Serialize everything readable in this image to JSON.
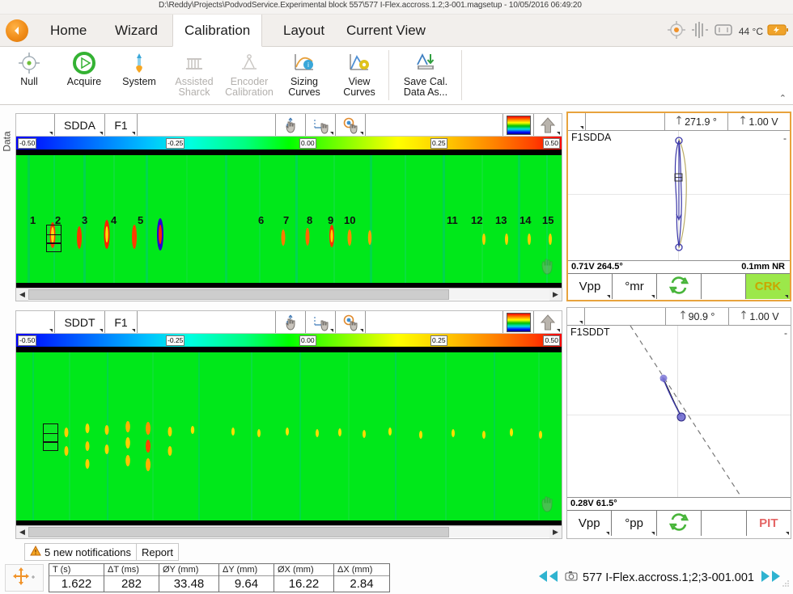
{
  "window": {
    "title": "D:\\Reddy\\Projects\\PodvodService.Experimental block 557\\577 I-Flex.accross.1.2;3-001.magsetup - 10/05/2016 06:49:20"
  },
  "ribbon": {
    "back_icon": "back-arrow-icon",
    "tabs": [
      {
        "label": "Home",
        "active": false
      },
      {
        "label": "Wizard",
        "active": false
      },
      {
        "label": "Calibration",
        "active": true
      },
      {
        "label": "Layout",
        "active": false
      },
      {
        "label": "Current View",
        "active": false
      }
    ],
    "status": {
      "probe_icon": "probe-target-icon",
      "signal_icon": "waveform-icon",
      "device_icon": "device-icon",
      "temperature": "44 °C",
      "battery_icon": "battery-icon"
    },
    "collapse_label": "⌃",
    "buttons": [
      {
        "label": "Null",
        "icon": "null-target-icon",
        "disabled": false
      },
      {
        "label": "Acquire",
        "icon": "play-circle-icon",
        "disabled": false
      },
      {
        "label": "System",
        "icon": "system-probe-icon",
        "disabled": false
      },
      {
        "label": "Assisted\nSharck",
        "icon": "assisted-sharck-icon",
        "disabled": true
      },
      {
        "label": "Encoder\nCalibration",
        "icon": "encoder-calibration-icon",
        "disabled": true
      },
      {
        "label": "Sizing\nCurves",
        "icon": "sizing-curves-icon",
        "disabled": false
      },
      {
        "label": "View\nCurves",
        "icon": "view-curves-icon",
        "disabled": false
      },
      {
        "label": "Save Cal.\nData As...",
        "icon": "save-cal-data-icon",
        "disabled": false
      }
    ]
  },
  "side_tab": {
    "label": "Data"
  },
  "cscans": [
    {
      "channel": "SDDA",
      "frequency": "F1",
      "tools": [
        "pan-tool-icon",
        "shift-tool-icon",
        "zoom-tool-icon"
      ],
      "palette_icon": "palette-swatch-icon",
      "arrow_icon": "arrow-up-icon",
      "colorbar": {
        "ticks": [
          "-0.50",
          "-0.25",
          "0.00",
          "0.25",
          "0.50"
        ]
      },
      "markers": [
        "1",
        "2",
        "3",
        "4",
        "5",
        "6",
        "7",
        "8",
        "9",
        "10",
        "11",
        "12",
        "13",
        "14",
        "15"
      ],
      "scroll_left_icon": "chevron-left-icon",
      "scroll_right_icon": "chevron-right-icon"
    },
    {
      "channel": "SDDT",
      "frequency": "F1",
      "tools": [
        "pan-tool-icon",
        "shift-tool-icon",
        "zoom-tool-icon"
      ],
      "palette_icon": "palette-swatch-icon",
      "arrow_icon": "arrow-up-icon",
      "colorbar": {
        "ticks": [
          "-0.50",
          "-0.25",
          "0.00",
          "0.25",
          "0.50"
        ]
      },
      "markers": [],
      "scroll_left_icon": "chevron-left-icon",
      "scroll_right_icon": "chevron-right-icon"
    }
  ],
  "lissajous": [
    {
      "selected": true,
      "rotation": "271.9 °",
      "gain": "1.00 V",
      "rotation_icon": "rotation-icon",
      "gain_icon": "gain-icon",
      "name": "F1SDDA",
      "minus_label": "-",
      "readout_left": "0.71V 264.5°",
      "readout_right": "0.1mm NR",
      "buttons": [
        {
          "label": "Vpp",
          "kind": "normal",
          "name": "vpp-button"
        },
        {
          "label": "°mr",
          "kind": "normal",
          "name": "angle-mr-button"
        },
        {
          "label": "",
          "kind": "refresh",
          "name": "refresh-button"
        },
        {
          "label": "",
          "kind": "blank",
          "name": "blank-button"
        },
        {
          "label": "CRK",
          "kind": "crk",
          "name": "crack-button"
        }
      ]
    },
    {
      "selected": false,
      "rotation": "90.9 °",
      "gain": "1.00 V",
      "rotation_icon": "rotation-icon",
      "gain_icon": "gain-icon",
      "name": "F1SDDT",
      "minus_label": "-",
      "readout_left": "0.28V 61.5°",
      "readout_right": "",
      "buttons": [
        {
          "label": "Vpp",
          "kind": "normal",
          "name": "vpp-button"
        },
        {
          "label": "°pp",
          "kind": "normal",
          "name": "angle-pp-button"
        },
        {
          "label": "",
          "kind": "refresh",
          "name": "refresh-button"
        },
        {
          "label": "",
          "kind": "blank",
          "name": "blank-button"
        },
        {
          "label": "PIT",
          "kind": "pit",
          "name": "pit-button"
        }
      ]
    }
  ],
  "notifications": {
    "warning_icon": "warning-triangle-icon",
    "text": "5 new notifications",
    "report_label": "Report"
  },
  "measurements": {
    "nav_pad_icon": "nav-pad-icon",
    "columns": [
      {
        "header": "T (s)",
        "value": "1.622"
      },
      {
        "header": "ΔT (ms)",
        "value": "282"
      },
      {
        "header": "ØY (mm)",
        "value": "33.48"
      },
      {
        "header": "ΔY (mm)",
        "value": "9.64"
      },
      {
        "header": "ØX (mm)",
        "value": "16.22"
      },
      {
        "header": "ΔX (mm)",
        "value": "2.84"
      }
    ]
  },
  "bottom_nav": {
    "prev_icon": "skip-previous-icon",
    "camera_icon": "camera-icon",
    "file_label": "577 I-Flex.accross.1;2;3-001.001",
    "next_icon": "skip-next-icon",
    "resize_icon": "resize-grip-icon"
  },
  "colors": {
    "accent_orange": "#e8a33d",
    "ribbon_bg": "#f2efec",
    "crk_green": "#9ce84a",
    "pit_red": "#e46565"
  }
}
